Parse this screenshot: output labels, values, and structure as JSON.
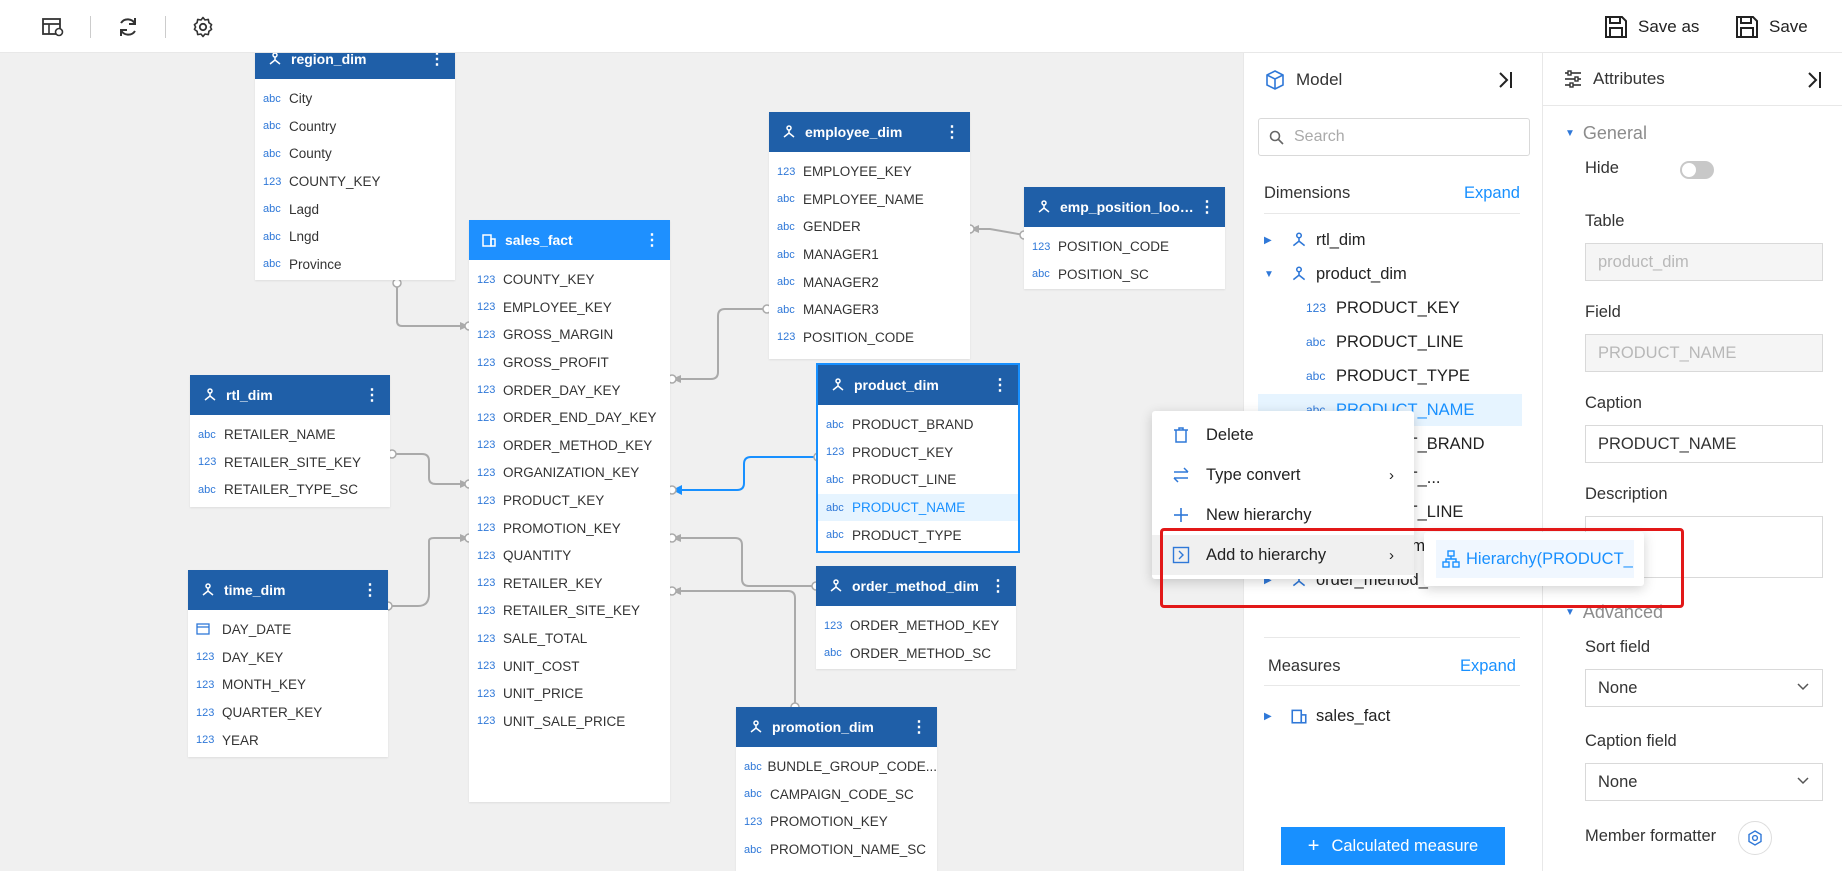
{
  "toolbar": {
    "save_as_label": "Save as",
    "save_label": "Save"
  },
  "canvas": {
    "region_dim": {
      "title": "region_dim",
      "fields": [
        {
          "type": "abc",
          "name": "City"
        },
        {
          "type": "abc",
          "name": "Country"
        },
        {
          "type": "abc",
          "name": "County"
        },
        {
          "type": "123",
          "name": "COUNTY_KEY"
        },
        {
          "type": "abc",
          "name": "Lagd"
        },
        {
          "type": "abc",
          "name": "Lngd"
        },
        {
          "type": "abc",
          "name": "Province"
        }
      ]
    },
    "sales_fact": {
      "title": "sales_fact",
      "fields": [
        {
          "type": "123",
          "name": "COUNTY_KEY"
        },
        {
          "type": "123",
          "name": "EMPLOYEE_KEY"
        },
        {
          "type": "123",
          "name": "GROSS_MARGIN"
        },
        {
          "type": "123",
          "name": "GROSS_PROFIT"
        },
        {
          "type": "123",
          "name": "ORDER_DAY_KEY"
        },
        {
          "type": "123",
          "name": "ORDER_END_DAY_KEY"
        },
        {
          "type": "123",
          "name": "ORDER_METHOD_KEY"
        },
        {
          "type": "123",
          "name": "ORGANIZATION_KEY"
        },
        {
          "type": "123",
          "name": "PRODUCT_KEY"
        },
        {
          "type": "123",
          "name": "PROMOTION_KEY"
        },
        {
          "type": "123",
          "name": "QUANTITY"
        },
        {
          "type": "123",
          "name": "RETAILER_KEY"
        },
        {
          "type": "123",
          "name": "RETAILER_SITE_KEY"
        },
        {
          "type": "123",
          "name": "SALE_TOTAL"
        },
        {
          "type": "123",
          "name": "UNIT_COST"
        },
        {
          "type": "123",
          "name": "UNIT_PRICE"
        },
        {
          "type": "123",
          "name": "UNIT_SALE_PRICE"
        }
      ]
    },
    "employee_dim": {
      "title": "employee_dim",
      "fields": [
        {
          "type": "123",
          "name": "EMPLOYEE_KEY"
        },
        {
          "type": "abc",
          "name": "EMPLOYEE_NAME"
        },
        {
          "type": "abc",
          "name": "GENDER"
        },
        {
          "type": "abc",
          "name": "MANAGER1"
        },
        {
          "type": "abc",
          "name": "MANAGER2"
        },
        {
          "type": "abc",
          "name": "MANAGER3"
        },
        {
          "type": "123",
          "name": "POSITION_CODE"
        }
      ]
    },
    "emp_position_lookup": {
      "title": "emp_position_look...",
      "fields": [
        {
          "type": "123",
          "name": "POSITION_CODE"
        },
        {
          "type": "abc",
          "name": "POSITION_SC"
        }
      ]
    },
    "rtl_dim": {
      "title": "rtl_dim",
      "fields": [
        {
          "type": "abc",
          "name": "RETAILER_NAME"
        },
        {
          "type": "123",
          "name": "RETAILER_SITE_KEY"
        },
        {
          "type": "abc",
          "name": "RETAILER_TYPE_SC"
        }
      ]
    },
    "product_dim": {
      "title": "product_dim",
      "fields": [
        {
          "type": "abc",
          "name": "PRODUCT_BRAND"
        },
        {
          "type": "123",
          "name": "PRODUCT_KEY"
        },
        {
          "type": "abc",
          "name": "PRODUCT_LINE"
        },
        {
          "type": "abc",
          "name": "PRODUCT_NAME"
        },
        {
          "type": "abc",
          "name": "PRODUCT_TYPE"
        }
      ]
    },
    "time_dim": {
      "title": "time_dim",
      "fields": [
        {
          "type": "date",
          "name": "DAY_DATE"
        },
        {
          "type": "123",
          "name": "DAY_KEY"
        },
        {
          "type": "123",
          "name": "MONTH_KEY"
        },
        {
          "type": "123",
          "name": "QUARTER_KEY"
        },
        {
          "type": "123",
          "name": "YEAR"
        }
      ]
    },
    "order_method_dim": {
      "title": "order_method_dim",
      "fields": [
        {
          "type": "123",
          "name": "ORDER_METHOD_KEY"
        },
        {
          "type": "abc",
          "name": "ORDER_METHOD_SC"
        }
      ]
    },
    "promotion_dim": {
      "title": "promotion_dim",
      "fields": [
        {
          "type": "abc",
          "name": "BUNDLE_GROUP_CODE..."
        },
        {
          "type": "abc",
          "name": "CAMPAIGN_CODE_SC"
        },
        {
          "type": "123",
          "name": "PROMOTION_KEY"
        },
        {
          "type": "abc",
          "name": "PROMOTION_NAME_SC"
        }
      ]
    }
  },
  "model": {
    "title": "Model",
    "search_placeholder": "Search",
    "dimensions_label": "Dimensions",
    "expand_label": "Expand",
    "dimensions": {
      "rtl_dim": "rtl_dim",
      "product_dim": "product_dim",
      "children": [
        {
          "type": "123",
          "name": "PRODUCT_KEY"
        },
        {
          "type": "abc",
          "name": "PRODUCT_LINE"
        },
        {
          "type": "abc",
          "name": "PRODUCT_TYPE"
        },
        {
          "type": "abc",
          "name": "PRODUCT_NAME"
        },
        {
          "type": "abc",
          "name": "PRODUCT_BRAND"
        },
        {
          "type": "abc",
          "name": "PRODUCT_..."
        },
        {
          "type": "abc",
          "name": "PRODUCT_LINE"
        }
      ],
      "promotion_dim": "promotion_dim",
      "order_method_dim": "order_method_dim"
    },
    "measures_label": "Measures",
    "measures_expand_label": "Expand",
    "sales_fact": "sales_fact",
    "calc_button": "Calculated measure"
  },
  "attributes": {
    "title": "Attributes",
    "general_label": "General",
    "hide_label": "Hide",
    "hide_on": false,
    "table_label": "Table",
    "table_value": "product_dim",
    "field_label": "Field",
    "field_value": "PRODUCT_NAME",
    "caption_label": "Caption",
    "caption_value": "PRODUCT_NAME",
    "description_label": "Description",
    "advanced_label": "Advanced",
    "sort_field_label": "Sort field",
    "sort_field_value": "None",
    "caption_field_label": "Caption field",
    "caption_field_value": "None",
    "member_formatter_label": "Member formatter"
  },
  "context_menu": {
    "delete": "Delete",
    "type_convert": "Type convert",
    "new_hierarchy": "New hierarchy",
    "add_to_hierarchy": "Add to hierarchy",
    "submenu_item": "Hierarchy(PRODUCT_NAME)"
  },
  "colors": {
    "header": "#1f5fa8",
    "fact_header": "#1e90ff",
    "accent": "#1890ff",
    "highlight_box": "#e21818"
  }
}
